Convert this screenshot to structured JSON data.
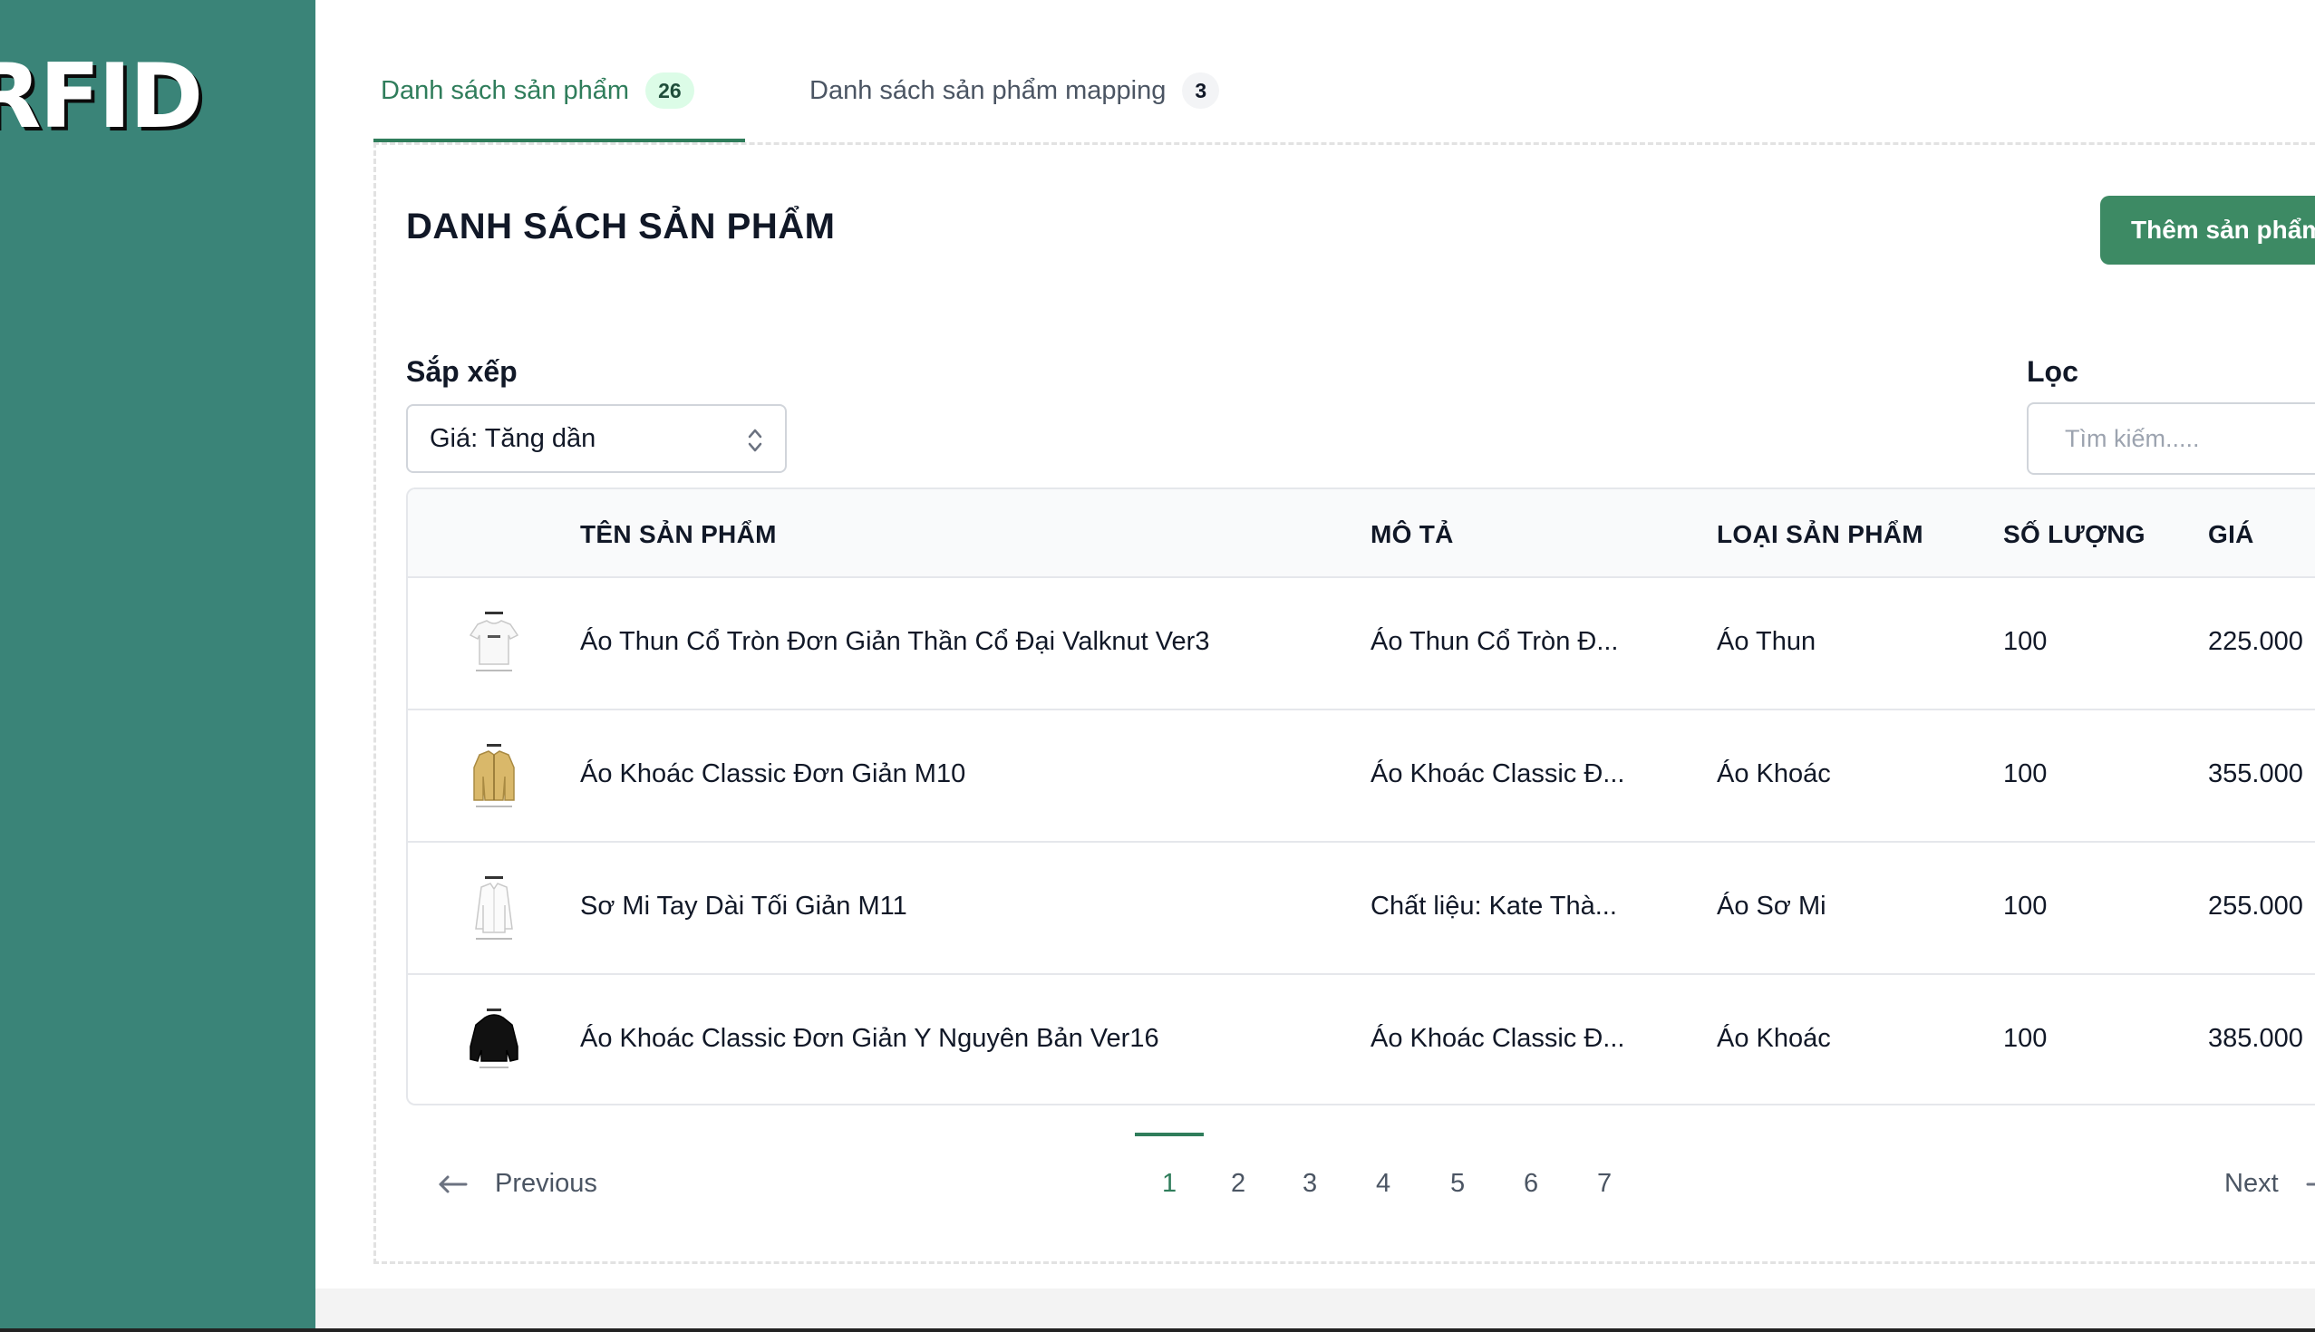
{
  "app": {
    "logo_text": "RFID"
  },
  "tabs": [
    {
      "label": "Danh sách sản phẩm",
      "count": "26"
    },
    {
      "label": "Danh sách sản phẩm mapping",
      "count": "3"
    }
  ],
  "page": {
    "title": "DANH SÁCH SẢN PHẨM",
    "add_button": "Thêm sản phẩm"
  },
  "sort": {
    "label": "Sắp xếp",
    "value": "Giá: Tăng dần"
  },
  "filter": {
    "label": "Lọc",
    "placeholder": "Tìm kiếm....."
  },
  "table": {
    "headers": [
      "TÊN SẢN PHẨM",
      "MÔ TẢ",
      "LOẠI SẢN PHẨM",
      "SỐ LƯỢNG",
      "GIÁ"
    ],
    "rows": [
      {
        "image": "white-tshirt-icon",
        "name": "Áo Thun Cổ Tròn Đơn Giản Thần Cổ Đại Valknut Ver3",
        "description": "Áo Thun Cổ Tròn Đ...",
        "type": "Áo Thun",
        "quantity": "100",
        "price": "225.000"
      },
      {
        "image": "yellow-jacket-icon",
        "name": "Áo Khoác Classic Đơn Giản M10",
        "description": "Áo Khoác Classic Đ...",
        "type": "Áo Khoác",
        "quantity": "100",
        "price": "355.000"
      },
      {
        "image": "white-shirt-icon",
        "name": "Sơ Mi Tay Dài Tối Giản M11",
        "description": "Chất liệu: Kate Thà...",
        "type": "Áo Sơ Mi",
        "quantity": "100",
        "price": "255.000"
      },
      {
        "image": "black-jacket-icon",
        "name": "Áo Khoác Classic Đơn Giản Y Nguyên Bản Ver16",
        "description": "Áo Khoác Classic Đ...",
        "type": "Áo Khoác",
        "quantity": "100",
        "price": "385.000"
      }
    ]
  },
  "pagination": {
    "previous": "Previous",
    "next": "Next",
    "pages": [
      "1",
      "2",
      "3",
      "4",
      "5",
      "6",
      "7"
    ],
    "current": "1"
  },
  "colors": {
    "sidebar": "#3a8478",
    "accent": "#2f7d5b",
    "button": "#3d8a64"
  }
}
